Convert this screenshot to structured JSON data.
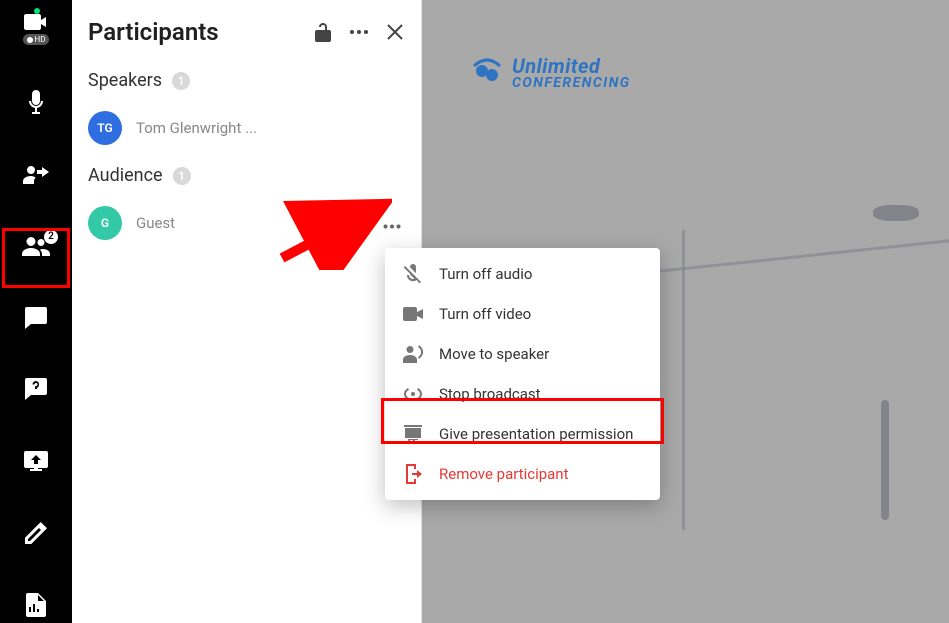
{
  "panel": {
    "title": "Participants",
    "sections": {
      "speakers": {
        "label": "Speakers",
        "count": "1"
      },
      "audience": {
        "label": "Audience",
        "count": "1"
      }
    },
    "participants": {
      "speaker1": {
        "initials": "TG",
        "name": "Tom Glenwright ..."
      },
      "audience1": {
        "initials": "G",
        "name": "Guest"
      }
    }
  },
  "toolbar": {
    "hd_label": "HD",
    "participants_badge": "2"
  },
  "logo": {
    "line1": "Unlimited",
    "line2": "Conferencing"
  },
  "menu": {
    "turn_off_audio": "Turn off audio",
    "turn_off_video": "Turn off video",
    "move_to_speaker": "Move to speaker",
    "stop_broadcast": "Stop broadcast",
    "give_presentation": "Give presentation permission",
    "remove_participant": "Remove participant"
  }
}
